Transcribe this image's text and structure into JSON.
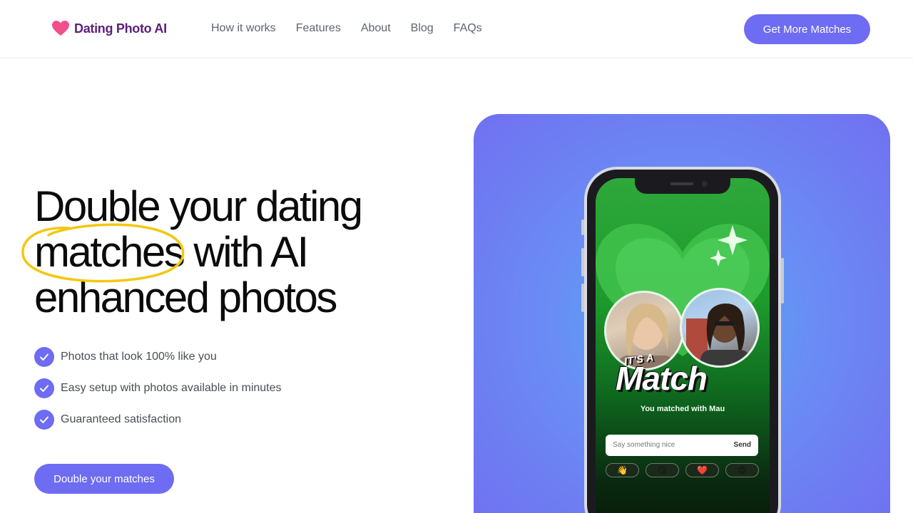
{
  "header": {
    "logo_text": "Dating Photo AI",
    "nav": [
      "How it works",
      "Features",
      "About",
      "Blog",
      "FAQs"
    ],
    "cta": "Get More Matches"
  },
  "hero": {
    "headline_lines": [
      "Double your dating",
      "matches with AI",
      "enhanced photos"
    ],
    "features": [
      "Photos that look 100% like you",
      "Easy setup with photos available in minutes",
      "Guaranteed satisfaction"
    ],
    "cta": "Double your matches"
  },
  "phone": {
    "its_a": "IT'S A",
    "match": "Match",
    "matched_with": "You matched with Mau",
    "message_placeholder": "Say something nice",
    "send": "Send",
    "emojis": [
      "👋",
      "😏",
      "❤️",
      "😍"
    ]
  },
  "colors": {
    "accent": "#6e6cf2",
    "logo": "#5b1f7a",
    "heart": "#f0508c",
    "highlight": "#f2c80f"
  }
}
